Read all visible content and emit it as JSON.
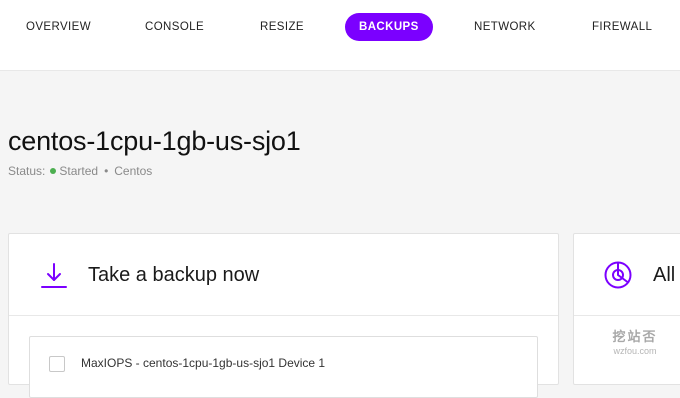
{
  "tabs": [
    {
      "label": "OVERVIEW",
      "active": false
    },
    {
      "label": "CONSOLE",
      "active": false
    },
    {
      "label": "RESIZE",
      "active": false
    },
    {
      "label": "BACKUPS",
      "active": true
    },
    {
      "label": "NETWORK",
      "active": false
    },
    {
      "label": "FIREWALL",
      "active": false
    }
  ],
  "server": {
    "name": "centos-1cpu-1gb-us-sjo1",
    "status_label": "Status:",
    "status_value": "Started",
    "separator": "•",
    "os": "Centos"
  },
  "backup_card": {
    "title": "Take a backup now",
    "icon": "download-icon",
    "device_label": "MaxIOPS - centos-1cpu-1gb-us-sjo1 Device 1"
  },
  "right_card": {
    "title": "All",
    "icon": "pie-chart-icon"
  },
  "watermark": {
    "main": "挖站否",
    "sub": "wzfou.com"
  },
  "colors": {
    "accent": "#7b00ff",
    "status_ok": "#4caf50",
    "background": "#f5f5f5"
  }
}
